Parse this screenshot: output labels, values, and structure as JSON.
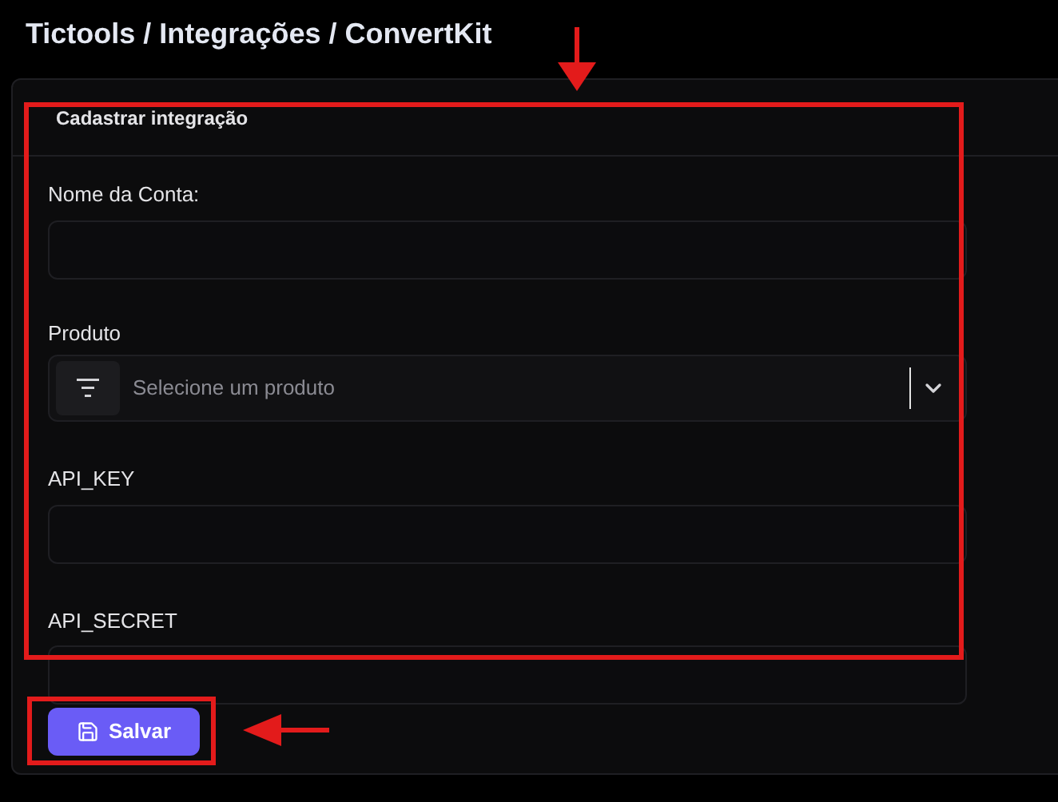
{
  "page_title": "Tictools / Integrações / ConvertKit",
  "card": {
    "title": "Cadastrar integração",
    "fields": [
      {
        "kind": "text",
        "label": "Nome da Conta:"
      },
      {
        "kind": "select",
        "label": "Produto",
        "placeholder": "Selecione um produto"
      },
      {
        "kind": "text",
        "label": "API_KEY"
      },
      {
        "kind": "text",
        "label": "API_SECRET"
      }
    ],
    "save_button": "Salvar"
  }
}
